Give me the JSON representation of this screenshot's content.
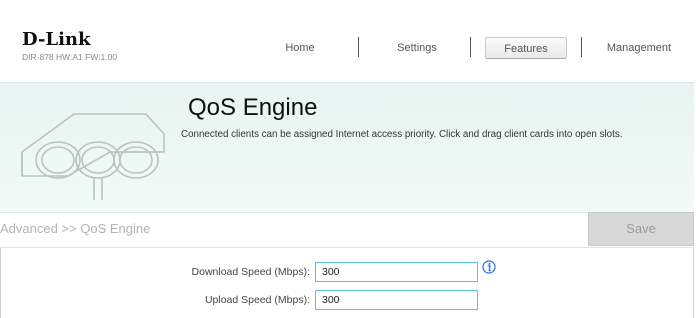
{
  "brand": {
    "logo_text": "D-Link",
    "model_line": "DIR-878 HW:A1 FW:1.00"
  },
  "nav": {
    "items": [
      {
        "label": "Home"
      },
      {
        "label": "Settings"
      },
      {
        "label": "Features"
      },
      {
        "label": "Management"
      }
    ],
    "active": "Features"
  },
  "banner": {
    "title": "QoS Engine",
    "description": "Connected clients can be assigned Internet access priority. Click and drag client cards into open slots."
  },
  "toolbar": {
    "breadcrumb": "Advanced >> QoS Engine",
    "save_label": "Save"
  },
  "form": {
    "download_label": "Download Speed (Mbps):",
    "download_value": "300",
    "upload_label": "Upload Speed (Mbps):",
    "upload_value": "300"
  },
  "colors": {
    "accent": "#5cc3d2",
    "banner_bg": "#e9f5f2",
    "save_bg": "#d8d8d8",
    "info_icon": "#2a6fd6"
  },
  "icons": [
    "router-illustration-icon",
    "info-icon"
  ]
}
